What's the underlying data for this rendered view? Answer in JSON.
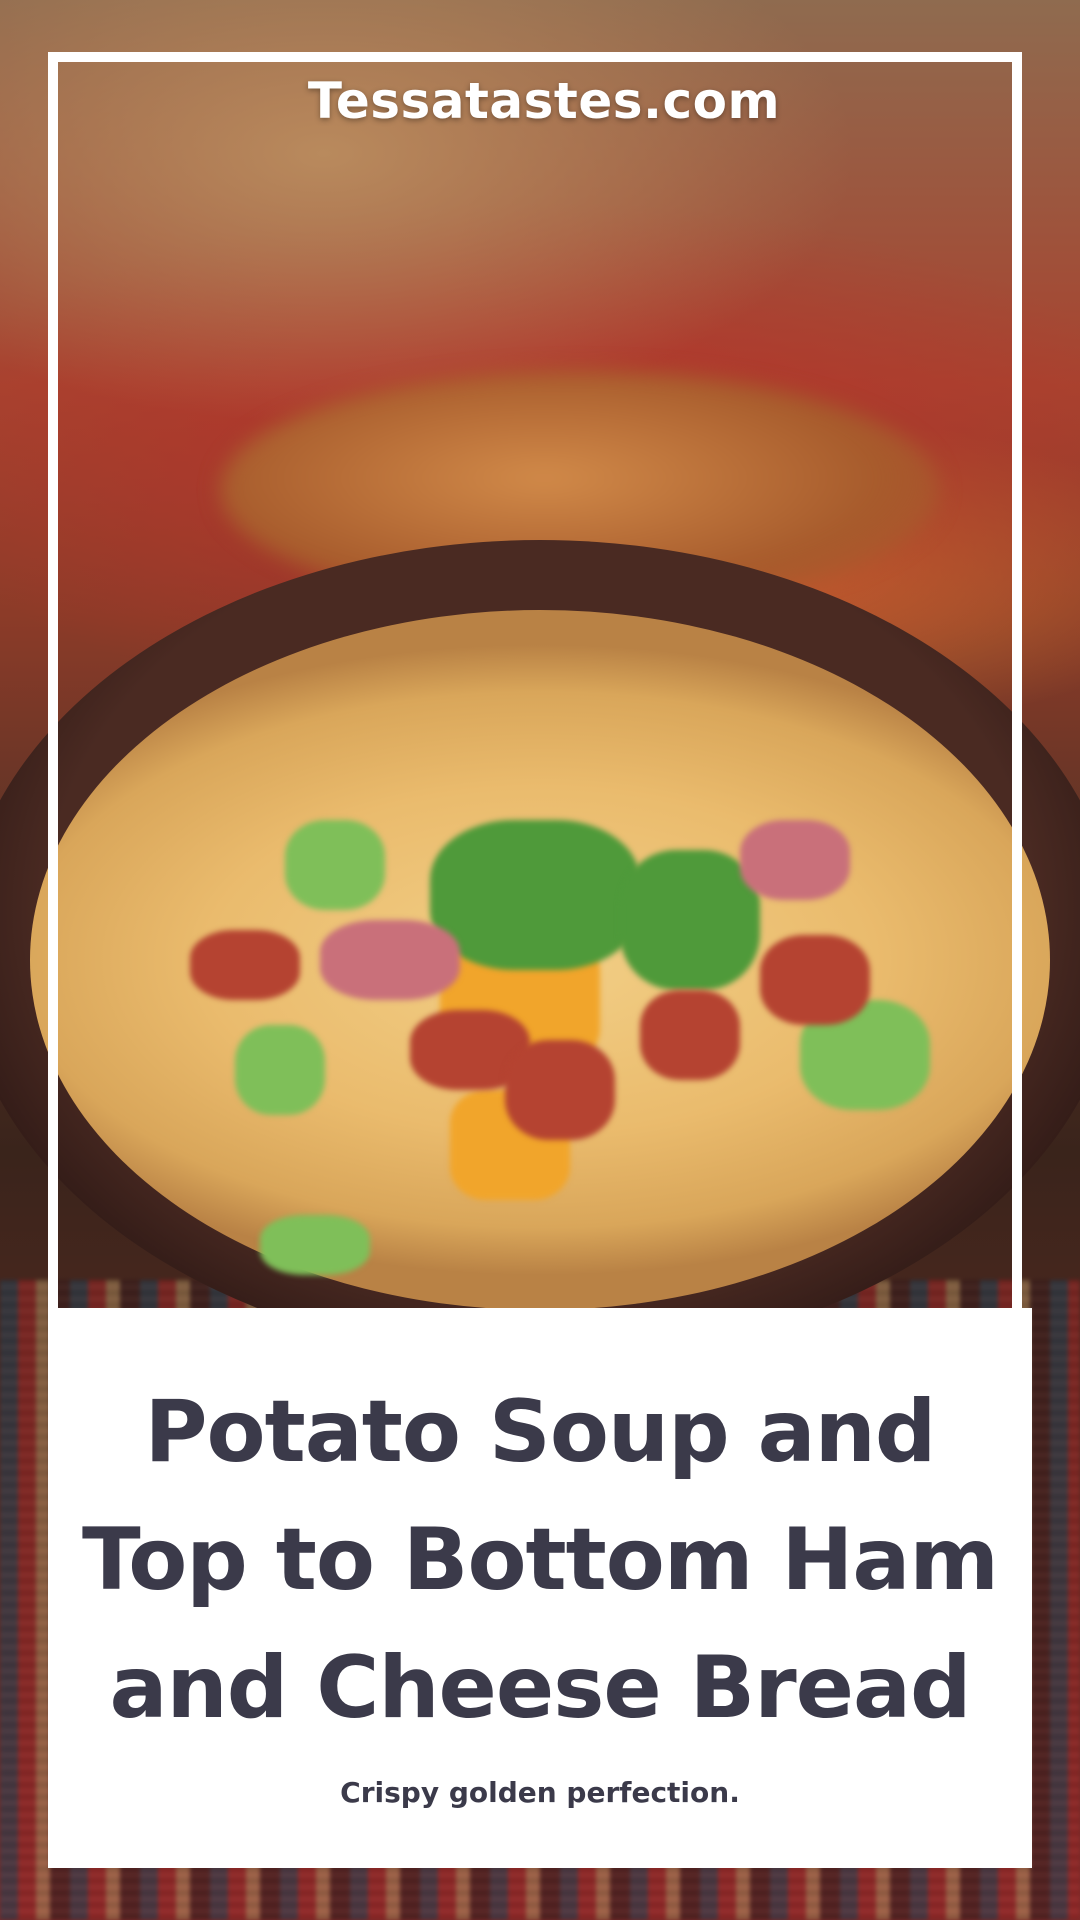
{
  "site": {
    "name": "Tessatastes.com"
  },
  "card": {
    "title": "Potato Soup and Top to Bottom Ham and Cheese Bread",
    "subtitle": "Crispy golden perfection."
  },
  "image": {
    "subject": "bowl of loaded potato soup with bread",
    "colors": {
      "soup": "#eabb6d",
      "bowl": "#3a241b",
      "rug_red": "#b5332b",
      "text": "#3b3a4a",
      "panel": "#ffffff"
    }
  }
}
